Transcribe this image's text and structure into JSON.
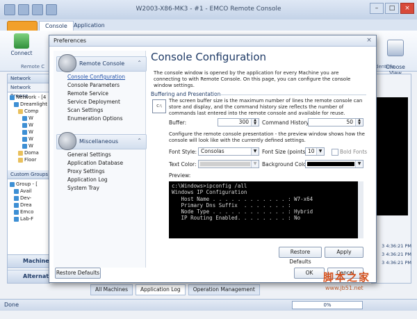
{
  "app": {
    "title": "W2003-X86-MK3 - #1 - EMCO Remote Console",
    "ribbon_tabs": [
      "Console",
      "Application"
    ],
    "ribbon_connect": "Connect",
    "ribbon_group_remote": "Remote C",
    "ribbon_choose_view": "Choose\nView",
    "ribbon_credentials": "dentials",
    "left_pane": {
      "network_header": "Network",
      "network_browser": "Network Browse",
      "tree": [
        "Network - [4",
        "Dreamlight",
        "Comp",
        "W",
        "W",
        "W",
        "W",
        "W",
        "Doma",
        "Floor"
      ],
      "custom_groups": "Custom Groups",
      "groups": [
        "Group - [",
        "Avail",
        "Dev-",
        "Drea",
        "Emco",
        "Lab-F"
      ],
      "nav_machines": "Machine",
      "nav_alternate": "Alternat"
    },
    "right_pane_stamps": [
      "3 4:36:21 PM",
      "3 4:36:21 PM",
      "3 4:36:21 PM"
    ],
    "bottom_tabs": [
      "All Machines",
      "Application Log",
      "Operation Management"
    ],
    "status": {
      "text": "Done",
      "progress": "0%"
    }
  },
  "dialog": {
    "title": "Preferences",
    "nav": {
      "group1": {
        "label": "Remote Console",
        "items": [
          "Console Configuration",
          "Console Parameters",
          "Remote Service",
          "Service Deployment",
          "Scan Settings",
          "Enumeration Options"
        ]
      },
      "group2": {
        "label": "Miscellaneous",
        "items": [
          "General Settings",
          "Application Database",
          "Proxy Settings",
          "Application Log",
          "System Tray"
        ]
      },
      "selected": "Console Configuration"
    },
    "content": {
      "title": "Console Configuration",
      "description": "The console window is opened by the application for every Machine you are connecting to with Remote Console. On this page, you can configure the console window settings.",
      "section": "Buffering and Presentation",
      "buffer_text": "The screen buffer size is the maximum number of lines the remote console can store and display, and the command history size reflects the number of commands last entered into the remote console and available for reuse.",
      "icon_text": "C:\\",
      "buffer_label": "Buffer:",
      "buffer_value": "300",
      "history_label": "Command History:",
      "history_value": "50",
      "presentation_text": "Configure the remote console presentation - the preview window shows how the console will look like with the currently defined settings.",
      "font_style_label": "Font Style:",
      "font_style_value": "Consolas",
      "font_size_label": "Font Size (points):",
      "font_size_value": "10",
      "bold_label": "Bold Fonts",
      "text_color_label": "Text Color:",
      "bg_color_label": "Background Color:",
      "text_color": "#c0c0c0",
      "bg_color": "#000000",
      "preview_label": "Preview:",
      "preview_lines": [
        "c:\\Windows>ipconfig /all",
        "",
        "Windows IP Configuration",
        "",
        "   Host Name . . . . . . . . . . . . : W7-x64",
        "   Primary Dns Suffix  . . . . . . . :",
        "   Node Type . . . . . . . . . . . . : Hybrid",
        "   IP Routing Enabled. . . . . . . . : No"
      ],
      "restore_page": "Restore Defaults",
      "apply": "Apply"
    },
    "restore_all": "Restore Defaults",
    "ok": "OK",
    "cancel": "Cancel"
  },
  "watermark": {
    "cn": "脚本之家",
    "url": "www.jb51.net"
  },
  "colors": {
    "accent": "#1e3a66",
    "app_orange": "#f2a02b",
    "watermark": "#d4521f"
  }
}
